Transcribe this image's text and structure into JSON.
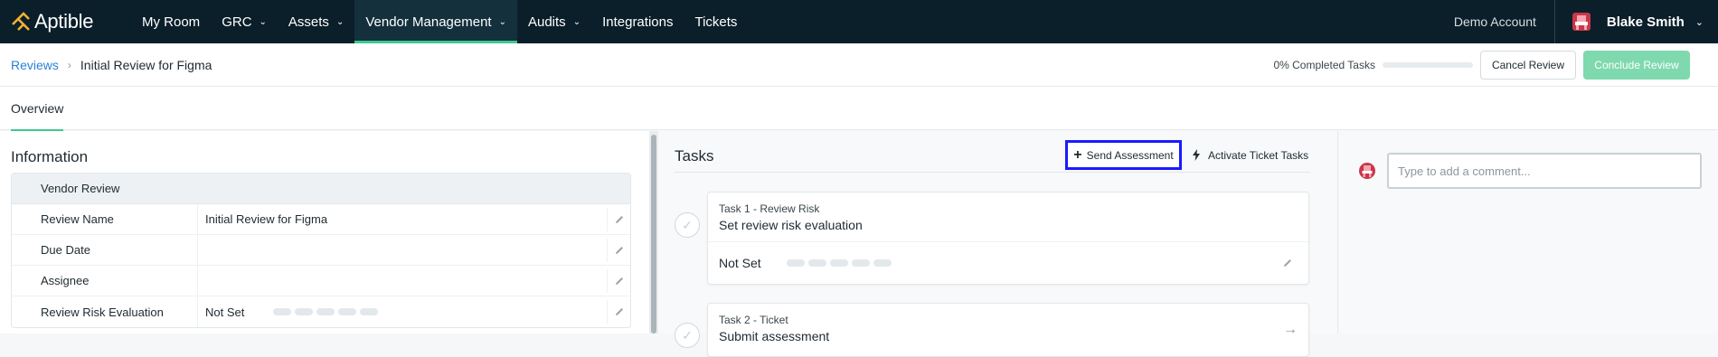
{
  "brand": {
    "name": "Aptible",
    "logo_icon": "aptible-logo-icon",
    "accent": "#3fc88f",
    "nav_bg": "#0b1f2a"
  },
  "nav": {
    "items": [
      {
        "label": "My Room",
        "has_menu": false
      },
      {
        "label": "GRC",
        "has_menu": true
      },
      {
        "label": "Assets",
        "has_menu": true
      },
      {
        "label": "Vendor Management",
        "has_menu": true,
        "active": true
      },
      {
        "label": "Audits",
        "has_menu": true
      },
      {
        "label": "Integrations",
        "has_menu": false
      },
      {
        "label": "Tickets",
        "has_menu": false
      }
    ],
    "demo_account": "Demo Account",
    "user_name": "Blake Smith"
  },
  "breadcrumb": {
    "parent": "Reviews",
    "current": "Initial Review for Figma"
  },
  "progress": {
    "text": "0% Completed Tasks",
    "value": 0
  },
  "header_actions": {
    "cancel": "Cancel Review",
    "conclude": "Conclude Review"
  },
  "tabs": [
    {
      "label": "Overview",
      "active": true
    }
  ],
  "information": {
    "title": "Information",
    "group": "Vendor Review",
    "rows": [
      {
        "label": "Review Name",
        "value": "Initial Review for Figma"
      },
      {
        "label": "Due Date",
        "value": ""
      },
      {
        "label": "Assignee",
        "value": ""
      },
      {
        "label": "Review Risk Evaluation",
        "value": "Not Set",
        "risk_level": 0,
        "risk_max": 5
      }
    ]
  },
  "tasks": {
    "title": "Tasks",
    "send_assessment": "Send Assessment",
    "activate_ticket_tasks": "Activate Ticket Tasks",
    "items": [
      {
        "subtitle": "Task 1 - Review Risk",
        "name": "Set review risk evaluation",
        "status": "Not Set",
        "risk_level": 0,
        "risk_max": 5
      },
      {
        "subtitle": "Task 2 - Ticket",
        "name": "Submit assessment"
      }
    ]
  },
  "comments": {
    "placeholder": "Type to add a comment..."
  }
}
